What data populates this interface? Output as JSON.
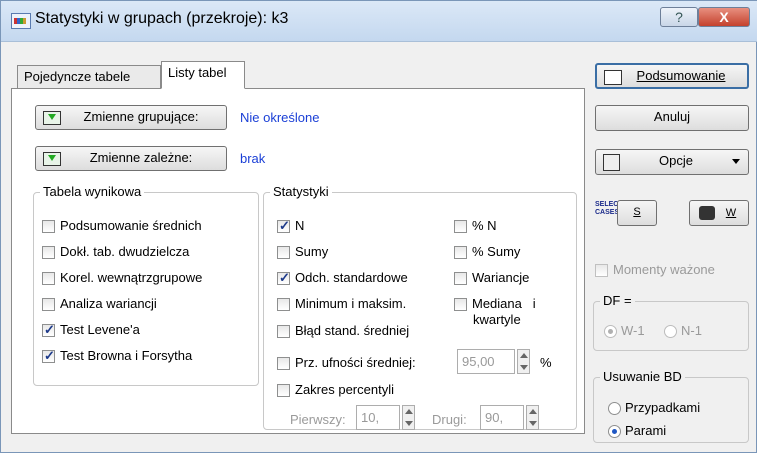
{
  "window": {
    "title": "Statystyki w grupach (przekroje): k3",
    "help": "?",
    "close": "X"
  },
  "tabs": [
    {
      "label": "Pojedyncze tabele"
    },
    {
      "label": "Listy tabel"
    }
  ],
  "grouping": {
    "button": "Zmienne grupujące:",
    "value": "Nie określone"
  },
  "dependent": {
    "button": "Zmienne zależne:",
    "value": "brak"
  },
  "tabela": {
    "label": "Tabela wynikowa",
    "items": [
      {
        "label": "Podsumowanie średnich",
        "checked": false
      },
      {
        "label": "Dokł. tab. dwudzielcza",
        "checked": false
      },
      {
        "label": "Korel. wewnątrzgrupowe",
        "checked": false
      },
      {
        "label": "Analiza wariancji",
        "checked": false
      },
      {
        "label": "Test Levene'a",
        "checked": true
      },
      {
        "label": "Test Browna i Forsytha",
        "checked": true
      }
    ]
  },
  "stats": {
    "label": "Statystyki",
    "left": [
      {
        "label": "N",
        "checked": true
      },
      {
        "label": "Sumy",
        "checked": false
      },
      {
        "label": "Odch. standardowe",
        "checked": true
      },
      {
        "label": "Minimum i maksim.",
        "checked": false
      },
      {
        "label": "Błąd stand. średniej",
        "checked": false
      }
    ],
    "right": [
      {
        "label": "% N",
        "checked": false
      },
      {
        "label": "% Sumy",
        "checked": false
      },
      {
        "label": "Wariancje",
        "checked": false
      },
      {
        "label": "Mediana   i",
        "label2": "kwartyle",
        "checked": false
      }
    ],
    "confidence": {
      "label": "Prz. ufności średniej:",
      "value": "95,00",
      "unit": "%",
      "checked": false
    },
    "percentile": {
      "label": "Zakres percentyli",
      "checked": false
    },
    "first": {
      "label": "Pierwszy:",
      "value": "10,"
    },
    "second": {
      "label": "Drugi:",
      "value": "90,"
    }
  },
  "right_panel": {
    "summary": "Podsumowanie",
    "cancel": "Anuluj",
    "options": "Opcje",
    "select_cases": "SELECT CASES",
    "s": "S",
    "w": "W",
    "weighted": "Momenty ważone",
    "df": {
      "label": "DF =",
      "options": [
        "W-1",
        "N-1"
      ]
    },
    "missing": {
      "label": "Usuwanie BD",
      "options": [
        "Przypadkami",
        "Parami"
      ]
    }
  }
}
